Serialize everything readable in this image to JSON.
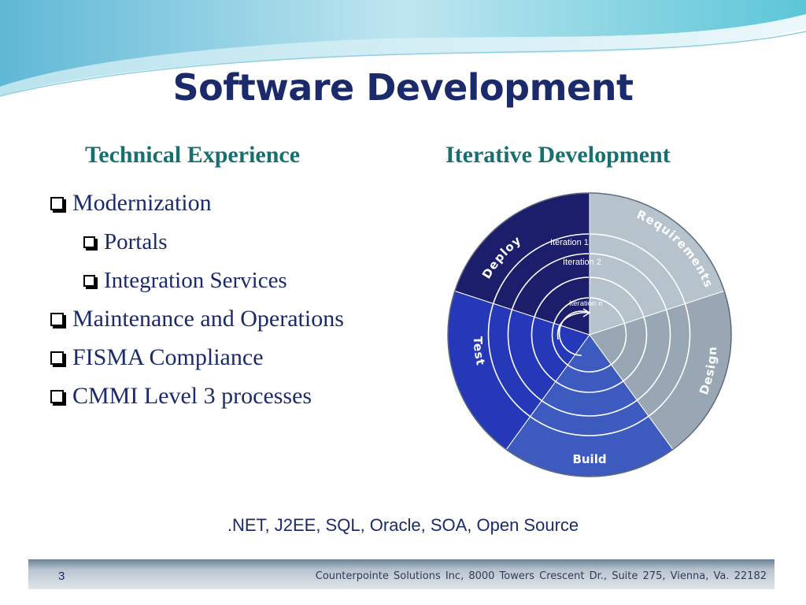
{
  "slide": {
    "title": "Software Development",
    "left_heading": "Technical Experience",
    "right_heading": "Iterative Development",
    "bullets": [
      "Modernization",
      "Portals",
      "Integration Services",
      "Maintenance and Operations",
      "FISMA Compliance",
      "CMMI Level 3 processes"
    ],
    "technologies": ".NET, J2EE, SQL, Oracle, SOA, Open Source"
  },
  "diagram": {
    "phases": [
      "Requirements",
      "Design",
      "Build",
      "Test",
      "Deploy"
    ],
    "iterations": [
      "Iteration 1",
      "Iteration 2",
      "Iteration n"
    ],
    "colors": {
      "requirements": "#b6c2cc",
      "design": "#98a7b3",
      "build": "#3d5bbf",
      "test": "#2438b8",
      "deploy": "#1c1d6b"
    }
  },
  "footer": {
    "page_number": "3",
    "company": "Counterpointe Solutions Inc, 8000 Towers Crescent Dr., Suite 275, Vienna, Va. 22182"
  },
  "theme": {
    "title_color": "#1b2a6b",
    "heading_color": "#17706f",
    "body_color": "#1b2a6b"
  }
}
